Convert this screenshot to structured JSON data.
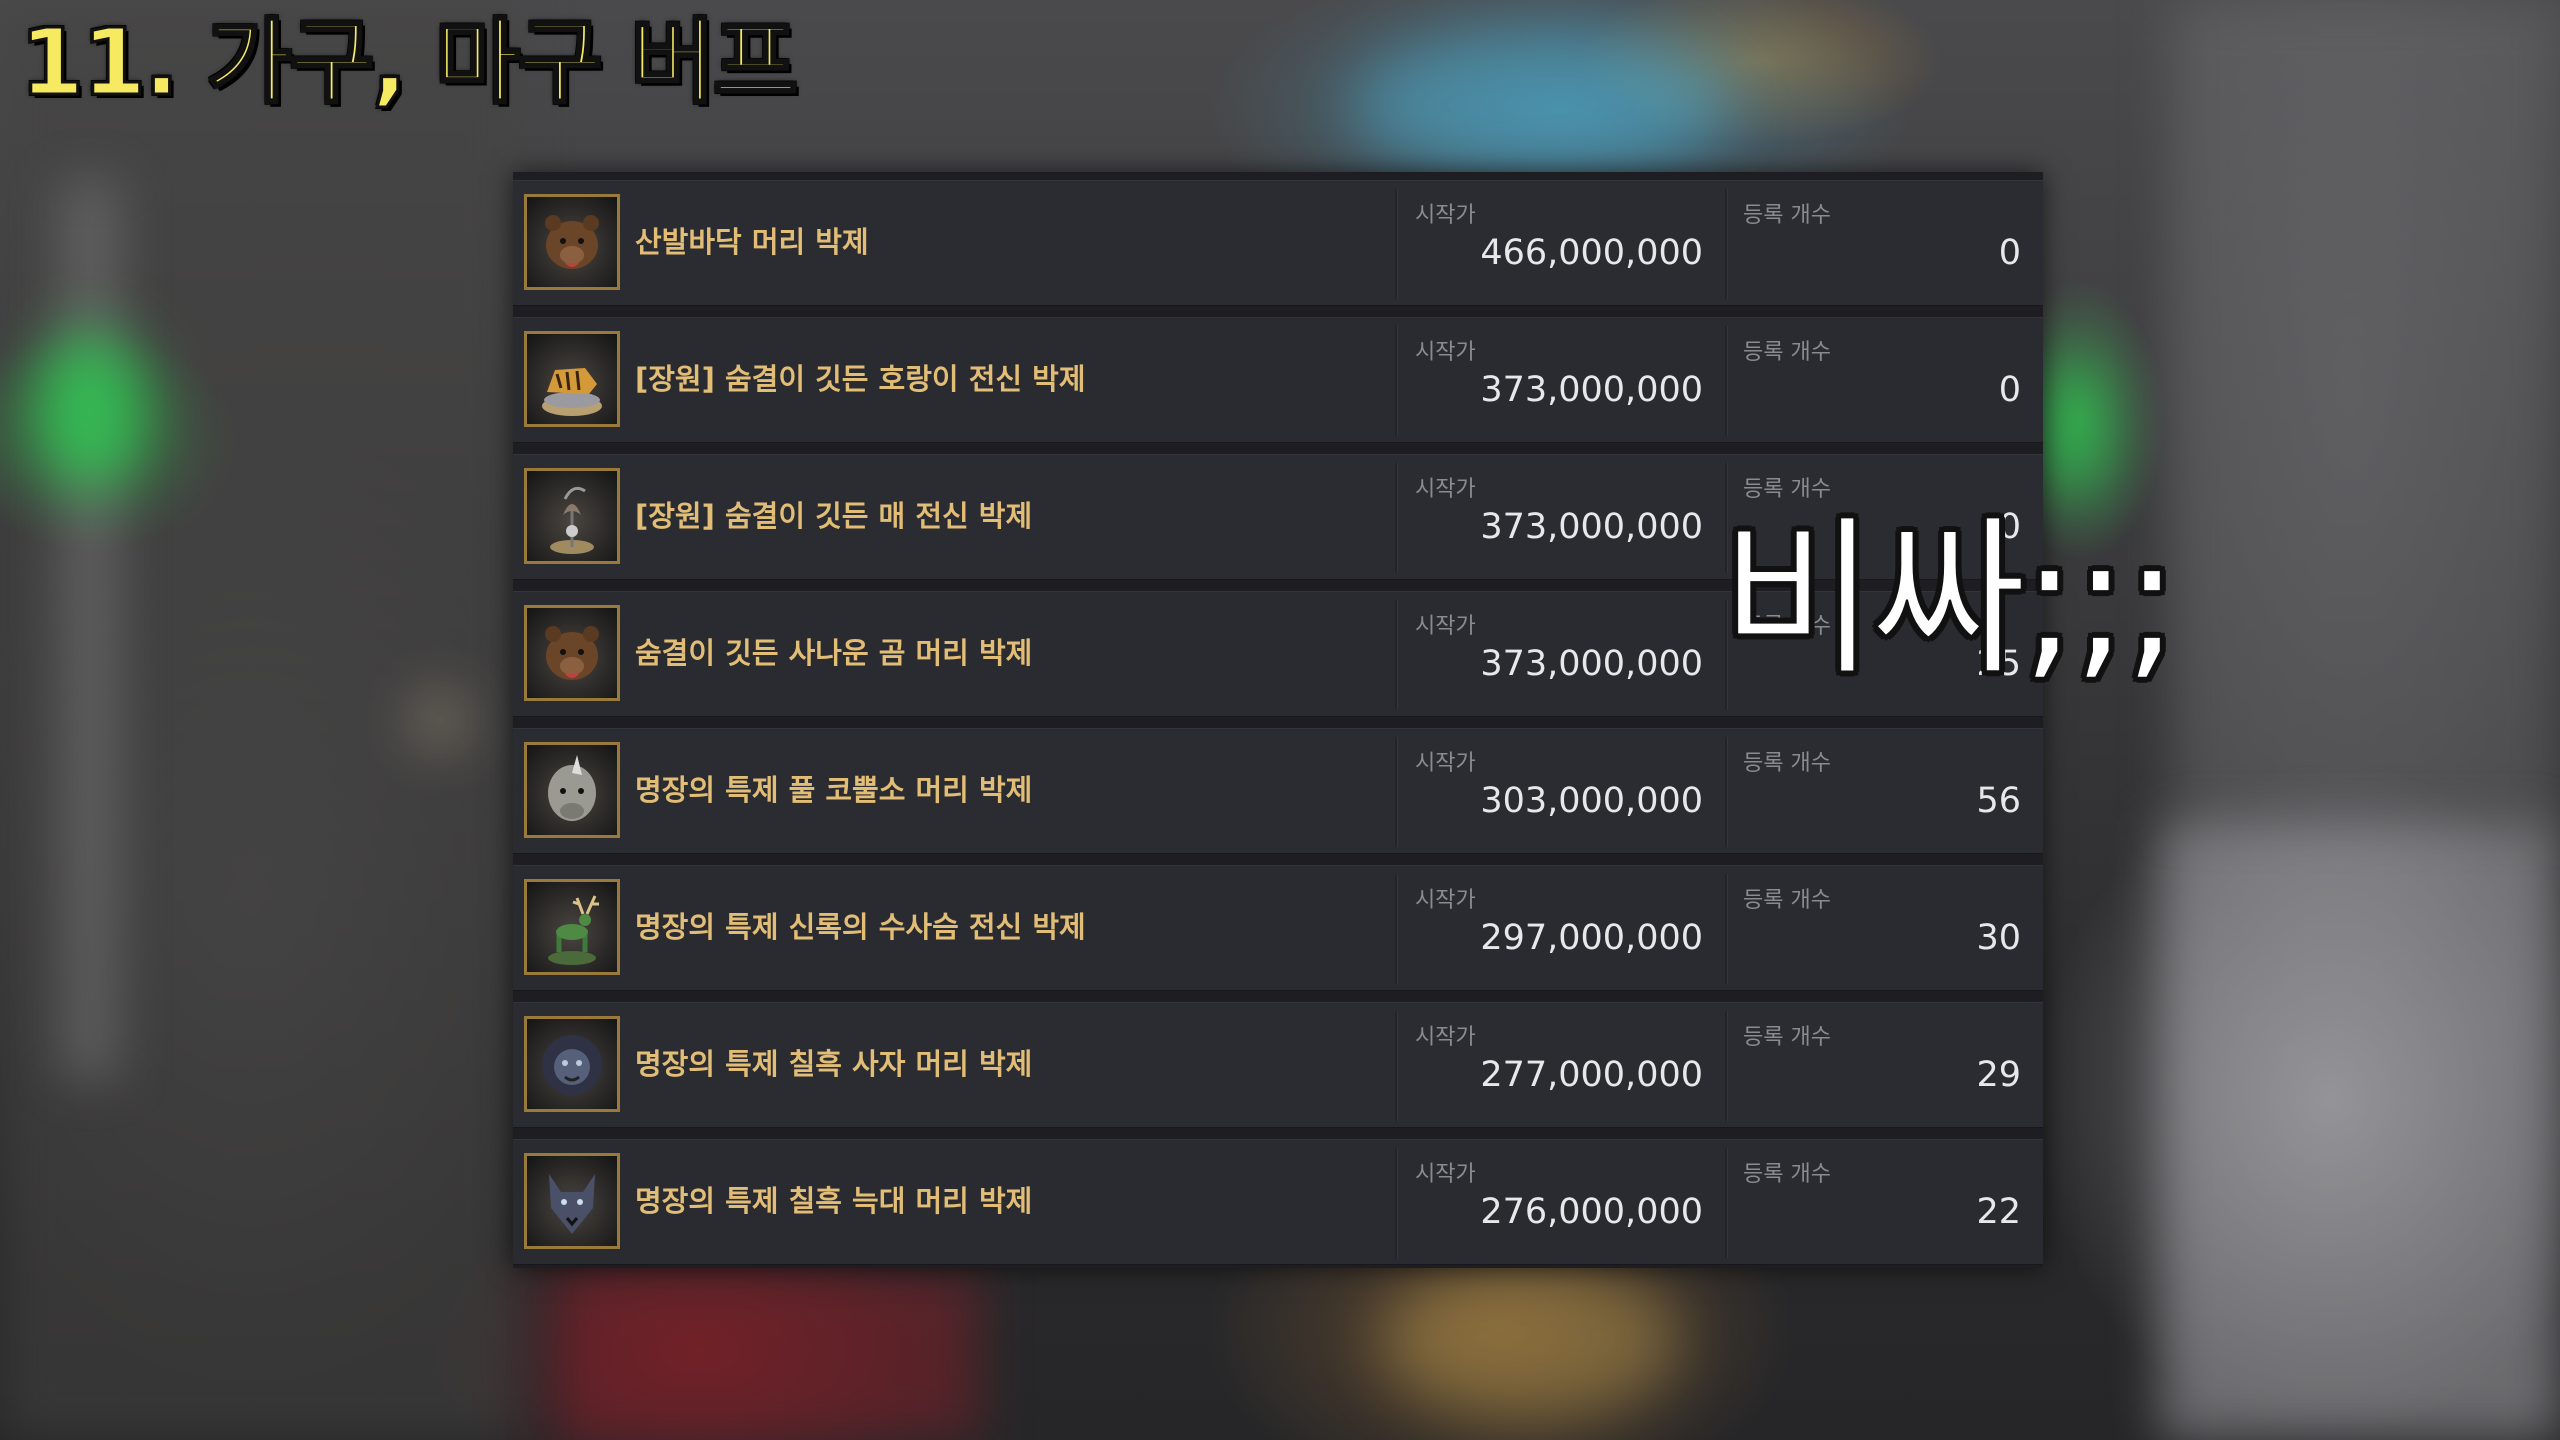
{
  "title": "11. 가구, 마구 버프",
  "comment": "비싸;;;",
  "columns": {
    "price_label": "시작가",
    "count_label": "등록 개수"
  },
  "colors": {
    "title": "#f6ea63",
    "item_name": "#e2bd76",
    "panel_bg": "#2a2b31",
    "icon_border": "#9a7a3a"
  },
  "items": [
    {
      "name": "산발바닥 머리 박제",
      "price": "466,000,000",
      "count": "0",
      "icon": "bear-head-trophy-icon"
    },
    {
      "name": "[장원] 숨결이 깃든 호랑이 전신 박제",
      "price": "373,000,000",
      "count": "0",
      "icon": "tiger-statue-icon"
    },
    {
      "name": "[장원] 숨결이 깃든 매 전신 박제",
      "price": "373,000,000",
      "count": "0",
      "icon": "hawk-perch-icon"
    },
    {
      "name": "숨결이 깃든 사나운 곰 머리 박제",
      "price": "373,000,000",
      "count": "25",
      "icon": "bear-head-trophy-icon"
    },
    {
      "name": "명장의 특제 풀 코뿔소 머리 박제",
      "price": "303,000,000",
      "count": "56",
      "icon": "rhino-head-trophy-icon"
    },
    {
      "name": "명장의 특제 신록의 수사슴 전신 박제",
      "price": "297,000,000",
      "count": "30",
      "icon": "stag-statue-icon"
    },
    {
      "name": "명장의 특제 칠흑 사자 머리 박제",
      "price": "277,000,000",
      "count": "29",
      "icon": "lion-head-trophy-icon"
    },
    {
      "name": "명장의 특제 칠흑 늑대 머리 박제",
      "price": "276,000,000",
      "count": "22",
      "icon": "wolf-head-trophy-icon"
    }
  ]
}
